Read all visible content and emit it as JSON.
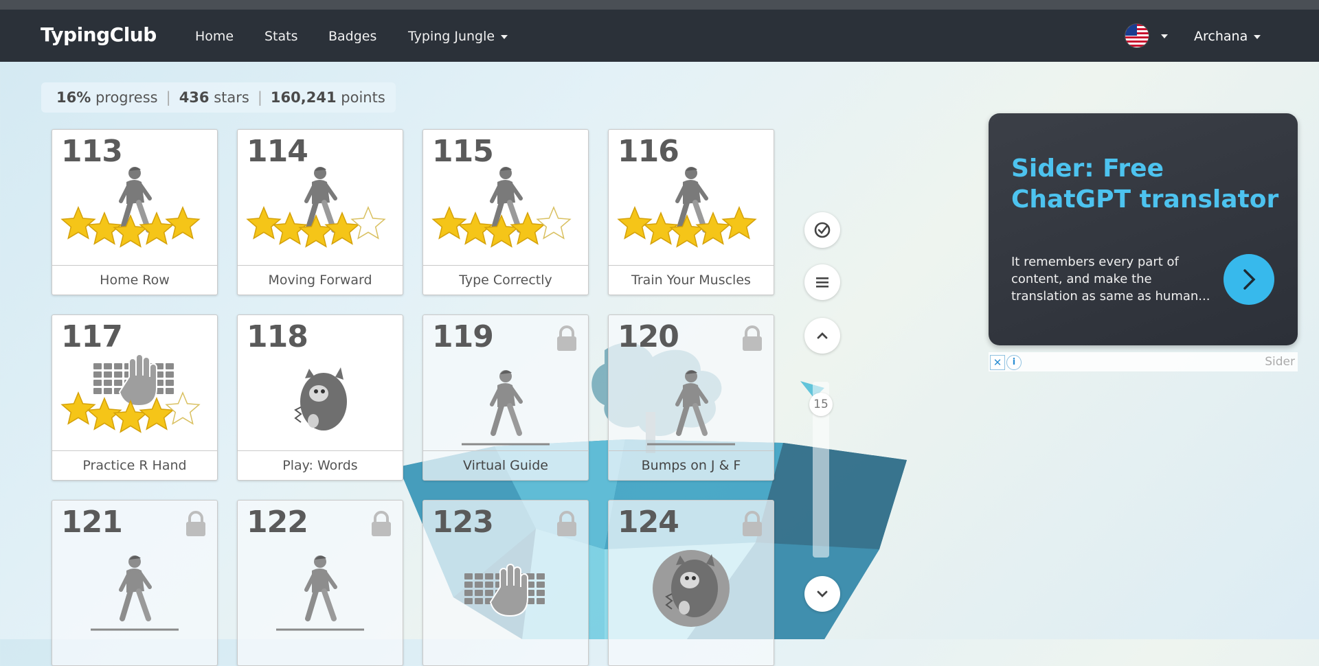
{
  "nav": {
    "brand": "TypingClub",
    "links": [
      "Home",
      "Stats",
      "Badges",
      "Typing Jungle"
    ],
    "user": "Archana"
  },
  "summary": {
    "progress_value": "16%",
    "progress_label": "progress",
    "stars_value": "436",
    "stars_label": "stars",
    "points_value": "160,241",
    "points_label": "points"
  },
  "lessons": [
    {
      "number": "113",
      "label": "Home Row",
      "art": "walking-person-icon",
      "stars": 5,
      "locked": false
    },
    {
      "number": "114",
      "label": "Moving Forward",
      "art": "walking-person-icon",
      "stars": 4,
      "locked": false
    },
    {
      "number": "115",
      "label": "Type Correctly",
      "art": "walking-person-icon",
      "stars": 4,
      "locked": false
    },
    {
      "number": "116",
      "label": "Train Your Muscles",
      "art": "walking-person-icon",
      "stars": 5,
      "locked": false
    },
    {
      "number": "117",
      "label": "Practice R Hand",
      "art": "keyboard-hand-icon",
      "stars": 4,
      "locked": false
    },
    {
      "number": "118",
      "label": "Play: Words",
      "art": "monster-game-icon",
      "stars": 0,
      "locked": false
    },
    {
      "number": "119",
      "label": "Virtual Guide",
      "art": "walking-person-icon",
      "stars": 0,
      "locked": true
    },
    {
      "number": "120",
      "label": "Bumps on J & F",
      "art": "walking-person-icon",
      "stars": 0,
      "locked": true
    },
    {
      "number": "121",
      "label": "",
      "art": "walking-person-icon",
      "stars": 0,
      "locked": true
    },
    {
      "number": "122",
      "label": "",
      "art": "walking-person-icon",
      "stars": 0,
      "locked": true
    },
    {
      "number": "123",
      "label": "",
      "art": "keyboard-hand-icon",
      "stars": 0,
      "locked": true
    },
    {
      "number": "124",
      "label": "",
      "art": "monster-game-icon",
      "stars": 0,
      "locked": true
    }
  ],
  "sidebar": {
    "scroll_page": "15"
  },
  "ad": {
    "title": "Sider: Free ChatGPT translator",
    "description": "It remembers every part of content, and make the translation as same as human...",
    "close_symbol": "✕",
    "info_symbol": "i",
    "brand": "Sider"
  },
  "colors": {
    "navbar": "#2b3139",
    "ad_title": "#4dc3ef",
    "ad_button": "#37b9ec",
    "star": "#f5c518"
  }
}
